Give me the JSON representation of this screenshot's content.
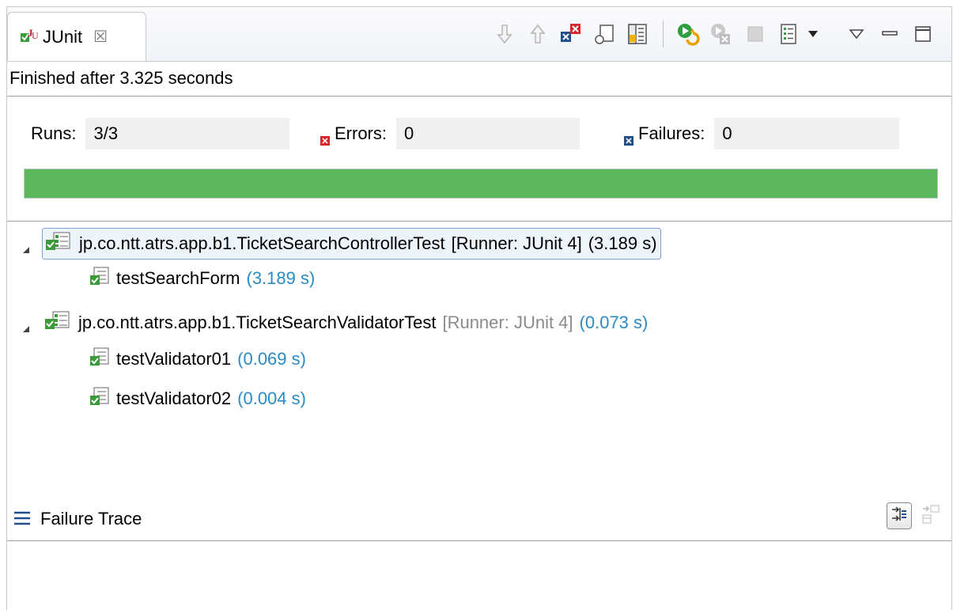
{
  "tab": {
    "title": "JUnit",
    "close_glyph": "☒",
    "icon": "junit-icon"
  },
  "toolbar": {
    "buttons": [
      {
        "name": "next-failure",
        "icon": "arrow-down-icon"
      },
      {
        "name": "previous-failure",
        "icon": "arrow-up-icon"
      },
      {
        "name": "show-failures-only",
        "icon": "failures-only-icon"
      },
      {
        "name": "scroll-lock",
        "icon": "scroll-lock-icon"
      },
      {
        "name": "layout",
        "icon": "layout-icon"
      },
      {
        "name": "rerun-test",
        "icon": "rerun-icon"
      },
      {
        "name": "rerun-failures-first",
        "icon": "rerun-failures-icon"
      },
      {
        "name": "stop-run",
        "icon": "stop-icon"
      },
      {
        "name": "test-run-history",
        "icon": "history-icon"
      }
    ]
  },
  "status": {
    "text": "Finished after 3.325 seconds"
  },
  "counters": {
    "runs": {
      "label": "Runs:",
      "value": "3/3"
    },
    "errors": {
      "label": "Errors:",
      "value": "0"
    },
    "failures": {
      "label": "Failures:",
      "value": "0"
    }
  },
  "progress": {
    "fraction": 1.0,
    "color": "#5cb85c"
  },
  "tree": {
    "suite1": {
      "name": "jp.co.ntt.atrs.app.b1.TicketSearchControllerTest",
      "runner": "[Runner: JUnit 4]",
      "time": "(3.189 s)",
      "tests": [
        {
          "name": "testSearchForm",
          "time": "(3.189 s)"
        }
      ]
    },
    "suite2": {
      "name": "jp.co.ntt.atrs.app.b1.TicketSearchValidatorTest",
      "runner": "[Runner: JUnit 4]",
      "time": "(0.073 s)",
      "tests": [
        {
          "name": "testValidator01",
          "time": "(0.069 s)"
        },
        {
          "name": "testValidator02",
          "time": "(0.004 s)"
        }
      ]
    }
  },
  "trace": {
    "label": "Failure Trace"
  },
  "colors": {
    "success": "#5cb85c",
    "timing": "#2a8bc4",
    "selection_border": "#7da2ce"
  }
}
